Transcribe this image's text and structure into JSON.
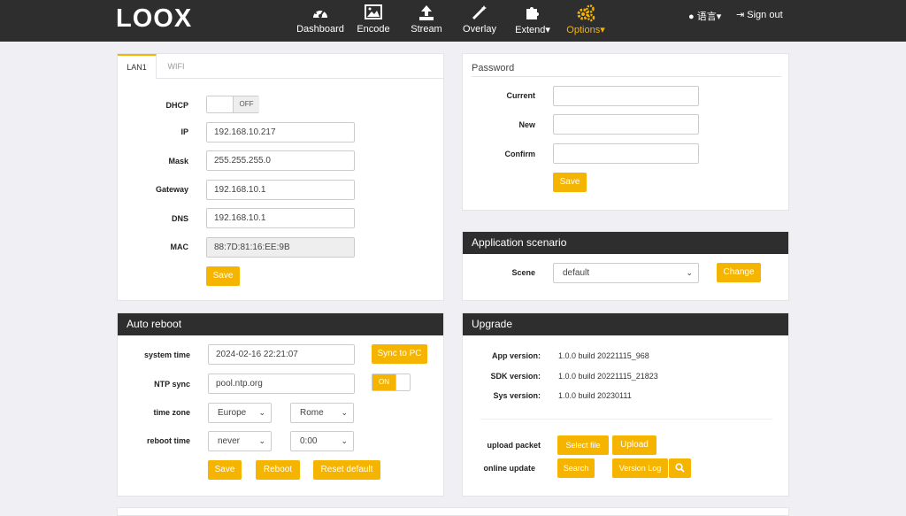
{
  "header": {
    "logo": "LOOX",
    "nav": [
      {
        "label": "Dashboard",
        "icon": "dashboard-icon"
      },
      {
        "label": "Encode",
        "icon": "image-icon"
      },
      {
        "label": "Stream",
        "icon": "upload-icon"
      },
      {
        "label": "Overlay",
        "icon": "magic-wand-icon"
      },
      {
        "label": "Extend▾",
        "icon": "puzzle-icon"
      },
      {
        "label": "Options▾",
        "icon": "gears-icon"
      }
    ],
    "language": "语言▾",
    "signout": "Sign out",
    "accent": "#f5b400"
  },
  "network": {
    "tabs": [
      "LAN1",
      "WIFI"
    ],
    "dhcp_label": "DHCP",
    "dhcp_state": "OFF",
    "ip_label": "IP",
    "ip": "192.168.10.217",
    "mask_label": "Mask",
    "mask": "255.255.255.0",
    "gateway_label": "Gateway",
    "gateway": "192.168.10.1",
    "dns_label": "DNS",
    "dns": "192.168.10.1",
    "mac_label": "MAC",
    "mac": "88:7D:81:16:EE:9B",
    "save": "Save"
  },
  "password": {
    "title": "Password",
    "current_label": "Current",
    "new_label": "New",
    "confirm_label": "Confirm",
    "save": "Save"
  },
  "scenario": {
    "title": "Application scenario",
    "scene_label": "Scene",
    "scene_value": "default",
    "change": "Change"
  },
  "autoreboot": {
    "title": "Auto reboot",
    "system_time_label": "system time",
    "system_time": "2024-02-16 22:21:07",
    "sync": "Sync to PC",
    "ntp_label": "NTP sync",
    "ntp_server": "pool.ntp.org",
    "ntp_state": "ON",
    "tz_label": "time zone",
    "tz_region": "Europe",
    "tz_city": "Rome",
    "reboot_label": "reboot time",
    "reboot_freq": "never",
    "reboot_time": "0:00",
    "save": "Save",
    "reboot": "Reboot",
    "reset": "Reset default"
  },
  "upgrade": {
    "title": "Upgrade",
    "app_label": "App version:",
    "app_value": "1.0.0 build 20221115_968",
    "sdk_label": "SDK version:",
    "sdk_value": "1.0.0 build 20221115_21823",
    "sys_label": "Sys version:",
    "sys_value": "1.0.0 build 20230111",
    "upload_label": "upload packet",
    "select_file": "Select file",
    "upload": "Upload",
    "online_label": "online update",
    "search": "Search",
    "version_log": "Version Log"
  }
}
